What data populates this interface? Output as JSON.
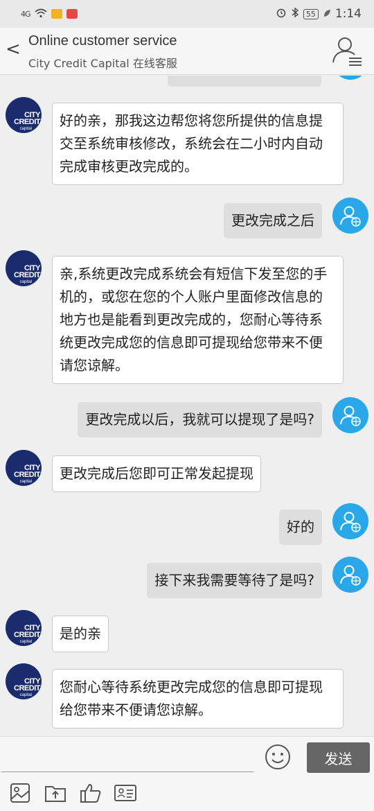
{
  "status_bar": {
    "signal": "4G",
    "battery": "55",
    "time": "1:14"
  },
  "header": {
    "title": "Online customer service",
    "subtitle": "City Credit Capital 在线客服",
    "back_label": "<"
  },
  "agent_avatar": {
    "line1": "CITY",
    "line2": "CREDIT",
    "line3": "capital"
  },
  "messages": [
    {
      "from": "agent",
      "text": "好的亲，那我这边帮您将您所提供的信息提交至系统审核修改，系统会在二小时内自动完成审核更改完成的。"
    },
    {
      "from": "user",
      "text": "更改完成之后"
    },
    {
      "from": "agent",
      "text": "亲,系统更改完成系统会有短信下发至您的手机的，或您在您的个人账户里面修改信息的地方也是能看到更改完成的，您耐心等待系统更改完成您的信息即可提现给您带来不便请您谅解。"
    },
    {
      "from": "user",
      "text": "更改完成以后，我就可以提现了是吗?"
    },
    {
      "from": "agent",
      "text": "更改完成后您即可正常发起提现"
    },
    {
      "from": "user",
      "text": "好的"
    },
    {
      "from": "user",
      "text": "接下来我需要等待了是吗?"
    },
    {
      "from": "agent",
      "text": "是的亲"
    },
    {
      "from": "agent",
      "text": "您耐心等待系统更改完成您的信息即可提现给您带来不便请您谅解。"
    }
  ],
  "input": {
    "value": "",
    "placeholder": ""
  },
  "send_label": "发送",
  "toolbar_icons": [
    "image-icon",
    "folder-upload-icon",
    "thumbs-up-icon",
    "contact-card-icon"
  ],
  "colors": {
    "agent_avatar": "#1b2c6e",
    "user_avatar": "#2aa7e8",
    "send_button": "#666666"
  }
}
